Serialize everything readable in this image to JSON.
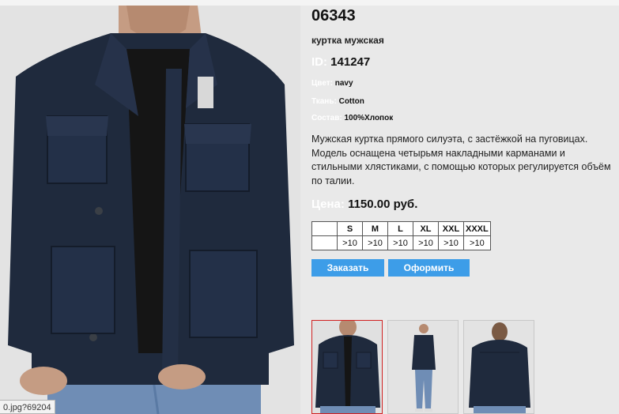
{
  "product": {
    "article": "06343",
    "name": "куртка мужская",
    "id_label": "ID:",
    "id_value": "141247",
    "color_label": "Цвет:",
    "color_value": "navy",
    "fabric_label": "Ткань:",
    "fabric_value": "Cotton",
    "composition_label": "Состав:",
    "composition_value": "100%Хлопок",
    "description": "Мужская куртка прямого силуэта, с застёжкой на пуговицах. Модель оснащена четырьмя накладными карманами и стильными хлястиками, с помощью которых регулируется объём по талии.",
    "price_label": "Цена:",
    "price_value": "1150.00 руб."
  },
  "sizes": {
    "labels": [
      "S",
      "M",
      "L",
      "XL",
      "XXL",
      "XXXL"
    ],
    "stock": [
      ">10",
      ">10",
      ">10",
      ">10",
      ">10",
      ">10"
    ]
  },
  "buttons": {
    "order": "Заказать",
    "checkout": "Оформить"
  },
  "status_url": "0.jpg?69204",
  "colors": {
    "page_bg": "#e9e9e9",
    "button_bg": "#3d9de8",
    "jacket": "#1f2a3d",
    "active_thumb_border": "#d02020"
  }
}
